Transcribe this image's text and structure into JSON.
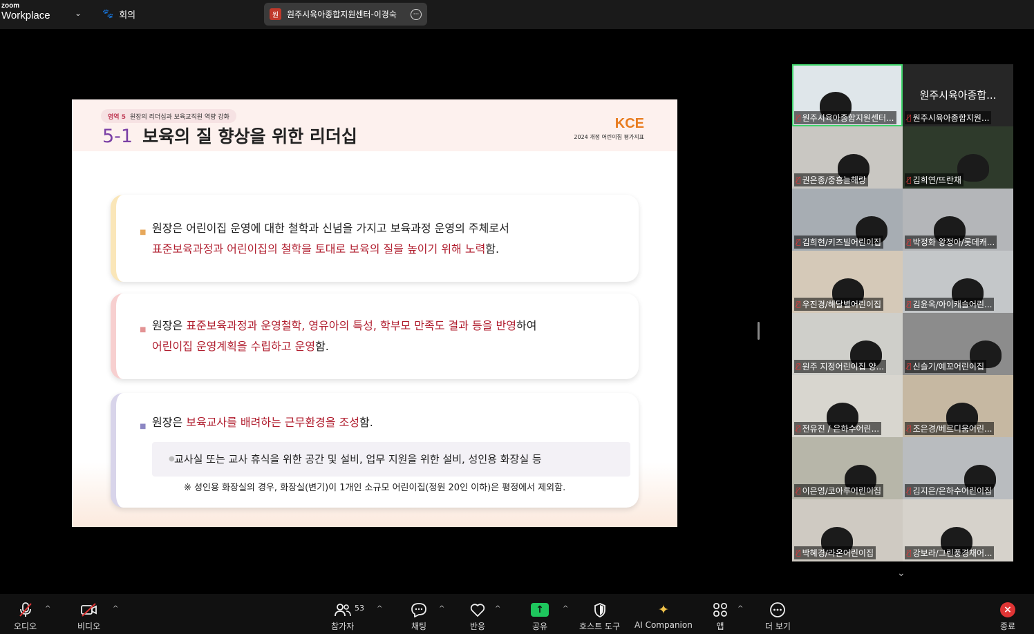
{
  "topbar": {
    "brand_small": "zoom",
    "brand_big": "Workplace",
    "meeting_label": "회의",
    "meeting_name": "원주시육아종합지원센터-이경숙",
    "meeting_badge": "원"
  },
  "slide": {
    "area_num": "영역 5",
    "area_label": "원장의 리더십과 보육교직원 역량 강화",
    "title_no": "5-1",
    "title": "보육의 질 향상을 위한 리더십",
    "logo_text": "KCE",
    "logo_sub": "2024 개정 어린이집 평가지표",
    "card1": {
      "line1": "원장은 어린이집 운영에 대한 철학과 신념을 가지고 보육과정 운영의 주체로서",
      "line2_red": "표준보육과정과 어린이집의 철학을 토대로 보육의 질을 높이기 위해 노력",
      "line2_end": "함."
    },
    "card2": {
      "line1_start": "원장은 ",
      "line1_red": "표준보육과정과 운영철학, 영유아의 특성, 학부모 만족도 결과 등을 반영",
      "line1_end": "하여",
      "line2_red": "어린이집 운영계획을 수립하고 운영",
      "line2_end": "함."
    },
    "card3": {
      "line1_start": "원장은 ",
      "line1_red": "보육교사를 배려하는 근무환경을 조성",
      "line1_end": "함.",
      "sub": "교사실 또는 교사 휴식을 위한 공간 및 설비, 업무 지원을 위한 설비,  성인용 화장실 등",
      "note": "※ 성인용 화장실의 경우,  화장실(변기)이 1개인 소규모 어린이집(정원 20인 이하)은 평정에서 제외함."
    }
  },
  "gallery": {
    "tiles": [
      {
        "name": "원주시육아종합지원센터..."
      },
      {
        "name": "원주시육아종합지원...",
        "big": "원주시육아종합..."
      },
      {
        "name": "권은종/중흥늘해랑"
      },
      {
        "name": "김희연/뜨란채"
      },
      {
        "name": "김희현/키즈빌어린이집"
      },
      {
        "name": "박정화 왕정아/롯데캐..."
      },
      {
        "name": "우진경/해달별어린이집"
      },
      {
        "name": "김윤옥/아이캐슬어린..."
      },
      {
        "name": "원주 지정어린이집 양..."
      },
      {
        "name": "신슬기/예꼬어린이집"
      },
      {
        "name": "전유진 / 은하수어린..."
      },
      {
        "name": "조은경/베르디움어린..."
      },
      {
        "name": "이은영/코아루어린이집"
      },
      {
        "name": "김지은/은하수어린이집"
      },
      {
        "name": "박혜경/라온어린이집"
      },
      {
        "name": "강보라/그린풍경채어..."
      }
    ]
  },
  "toolbar": {
    "audio": "오디오",
    "video": "비디오",
    "participants": "참가자",
    "participants_count": "53",
    "chat": "채팅",
    "react": "반응",
    "share": "공유",
    "host_tools": "호스트 도구",
    "ai": "AI Companion",
    "apps": "앱",
    "more": "더 보기",
    "end": "종료"
  },
  "colors": {
    "accent_red": "#b01d2e",
    "share_green": "#1ec65d",
    "end_red": "#e03535",
    "active_speaker": "#40d46c"
  }
}
